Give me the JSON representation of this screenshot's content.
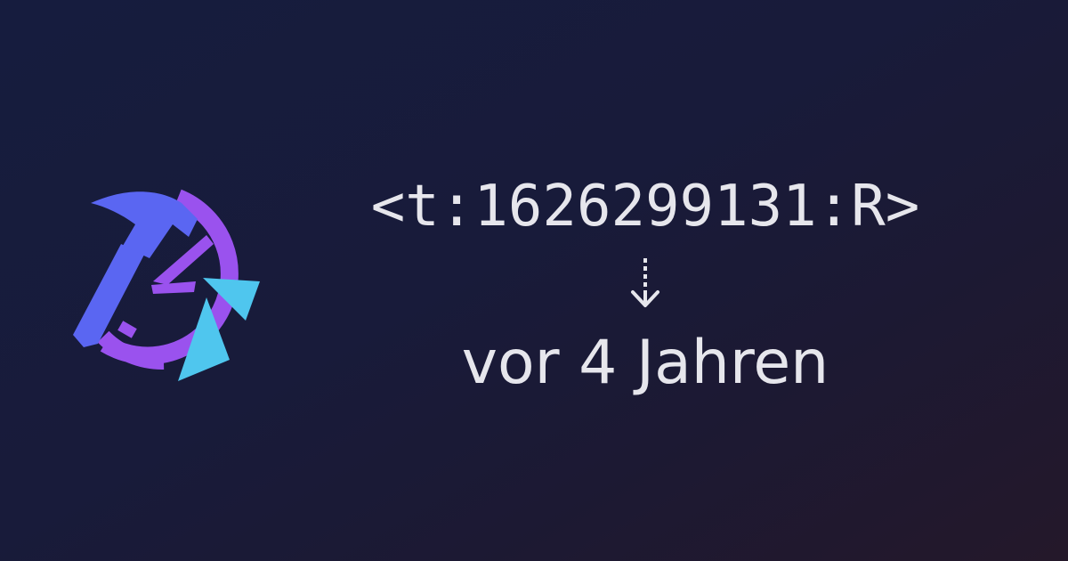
{
  "logo": {
    "icon": "hammer-clock-logo-icon",
    "colors": {
      "hammer": "#5a66f2",
      "clock": "#9a52ee",
      "triangle": "#4fc6ee"
    }
  },
  "timestamp_code": "<t:1626299131:R>",
  "arrow": {
    "icon": "dotted-arrow-down-icon"
  },
  "relative_time": "vor 4 Jahren",
  "text_color": "#e6e6ec",
  "background_colors": [
    "#161c3e",
    "#24182a"
  ]
}
